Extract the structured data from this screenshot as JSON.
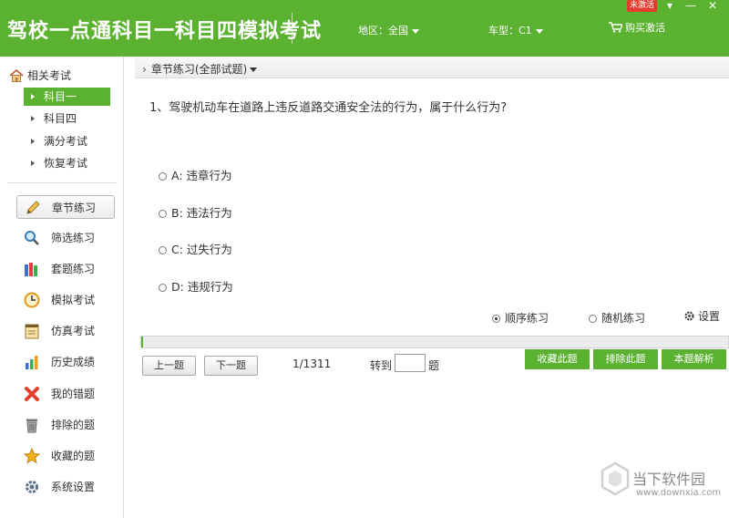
{
  "header": {
    "title": "驾校一点通科目一科目四模拟考试",
    "region_label": "地区：全国",
    "car_type_label": "车型：C1",
    "buy_label": "购买激活",
    "unactivated_badge": "未激活",
    "window_menu": "▾",
    "window_min": "—",
    "window_close": "✕"
  },
  "sidebar": {
    "section_title": "相关考试",
    "sub_items": [
      {
        "label": "科目一",
        "active": true
      },
      {
        "label": "科目四",
        "active": false
      },
      {
        "label": "满分考试",
        "active": false
      },
      {
        "label": "恢复考试",
        "active": false
      }
    ],
    "nav_items": [
      {
        "label": "章节练习",
        "icon": "pencil-icon",
        "active": true
      },
      {
        "label": "筛选练习",
        "icon": "magnifier-icon",
        "active": false
      },
      {
        "label": "套题练习",
        "icon": "books-icon",
        "active": false
      },
      {
        "label": "模拟考试",
        "icon": "clock-icon",
        "active": false
      },
      {
        "label": "仿真考试",
        "icon": "notepad-icon",
        "active": false
      },
      {
        "label": "历史成绩",
        "icon": "bar-chart-icon",
        "active": false
      },
      {
        "label": "我的错题",
        "icon": "red-x-icon",
        "active": false
      },
      {
        "label": "排除的题",
        "icon": "trash-icon",
        "active": false
      },
      {
        "label": "收藏的题",
        "icon": "star-icon",
        "active": false
      },
      {
        "label": "系统设置",
        "icon": "gear-icon",
        "active": false
      }
    ]
  },
  "main": {
    "breadcrumb": "章节练习(全部试题)",
    "question": "1、驾驶机动车在道路上违反道路交通安全法的行为，属于什么行为?",
    "options": [
      {
        "label": "A: 违章行为"
      },
      {
        "label": "B: 违法行为"
      },
      {
        "label": "C: 过失行为"
      },
      {
        "label": "D: 违规行为"
      }
    ],
    "mode_sequential": "顺序练习",
    "mode_random": "随机练习",
    "settings_label": "设置",
    "progress_fraction": 0.0008,
    "prev_button": "上一题",
    "next_button": "下一题",
    "page_count": "1/1311",
    "goto_label": "转到",
    "goto_suffix": "题",
    "goto_value": "",
    "favorite_button": "收藏此题",
    "exclude_button": "排除此题",
    "analysis_button": "本题解析"
  },
  "watermark": {
    "text": "当下软件园",
    "url": "www.downxia.com"
  },
  "colors": {
    "accent": "#5bb230",
    "badge": "#e63b2e"
  }
}
